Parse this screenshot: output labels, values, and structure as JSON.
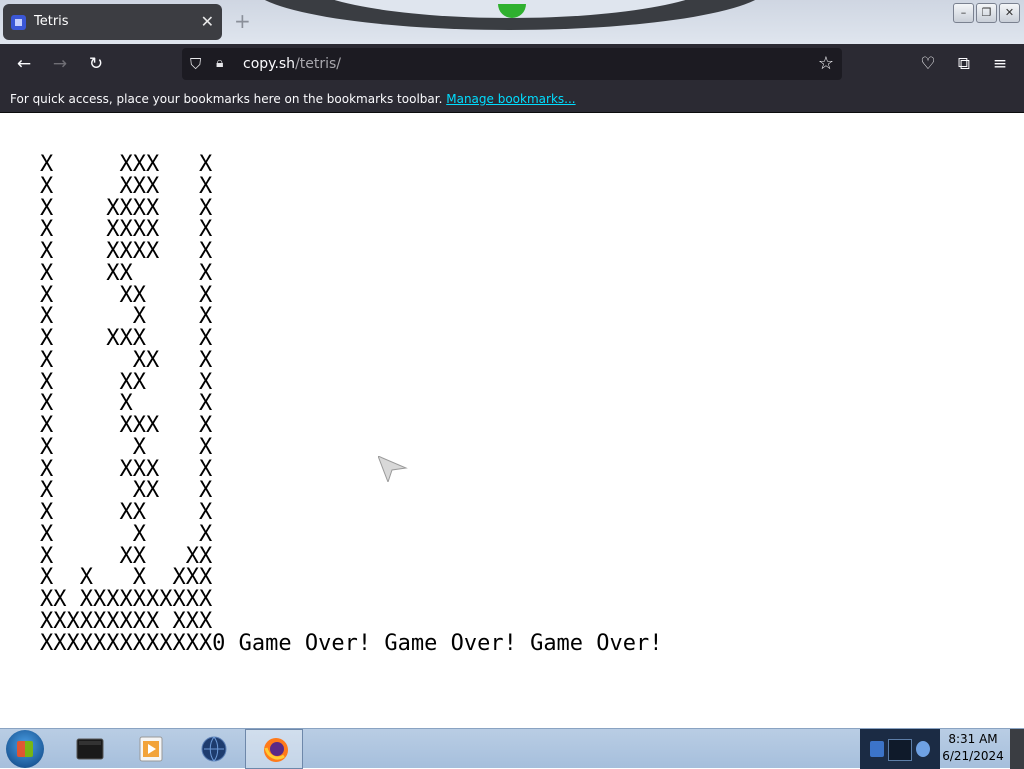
{
  "browser": {
    "tab": {
      "title": "Tetris"
    },
    "url": {
      "host": "copy.sh",
      "path": "/tetris/"
    },
    "bookmarks_bar": {
      "message": "For quick access, place your bookmarks here on the bookmarks toolbar.",
      "manage_link": "Manage bookmarks..."
    }
  },
  "game": {
    "board_lines": [
      "X     XXX   X",
      "X     XXX   X",
      "X    XXXX   X",
      "X    XXXX   X",
      "X    XXXX   X",
      "X    XX     X",
      "X     XX    X",
      "X      X    X",
      "X    XXX    X",
      "X      XX   X",
      "X     XX    X",
      "X     X     X",
      "X     XXX   X",
      "X      X    X",
      "X     XXX   X",
      "X      XX   X",
      "X     XX    X",
      "X      X    X",
      "X     XX   XX",
      "X  X   X  XXX",
      "XX XXXXXXXXXX",
      "XXXXXXXXX XXX",
      "XXXXXXXXXXXXX0 Game Over! Game Over! Game Over!"
    ]
  },
  "taskbar": {
    "clock": {
      "time": "8:31 AM",
      "date": "6/21/2024"
    }
  }
}
